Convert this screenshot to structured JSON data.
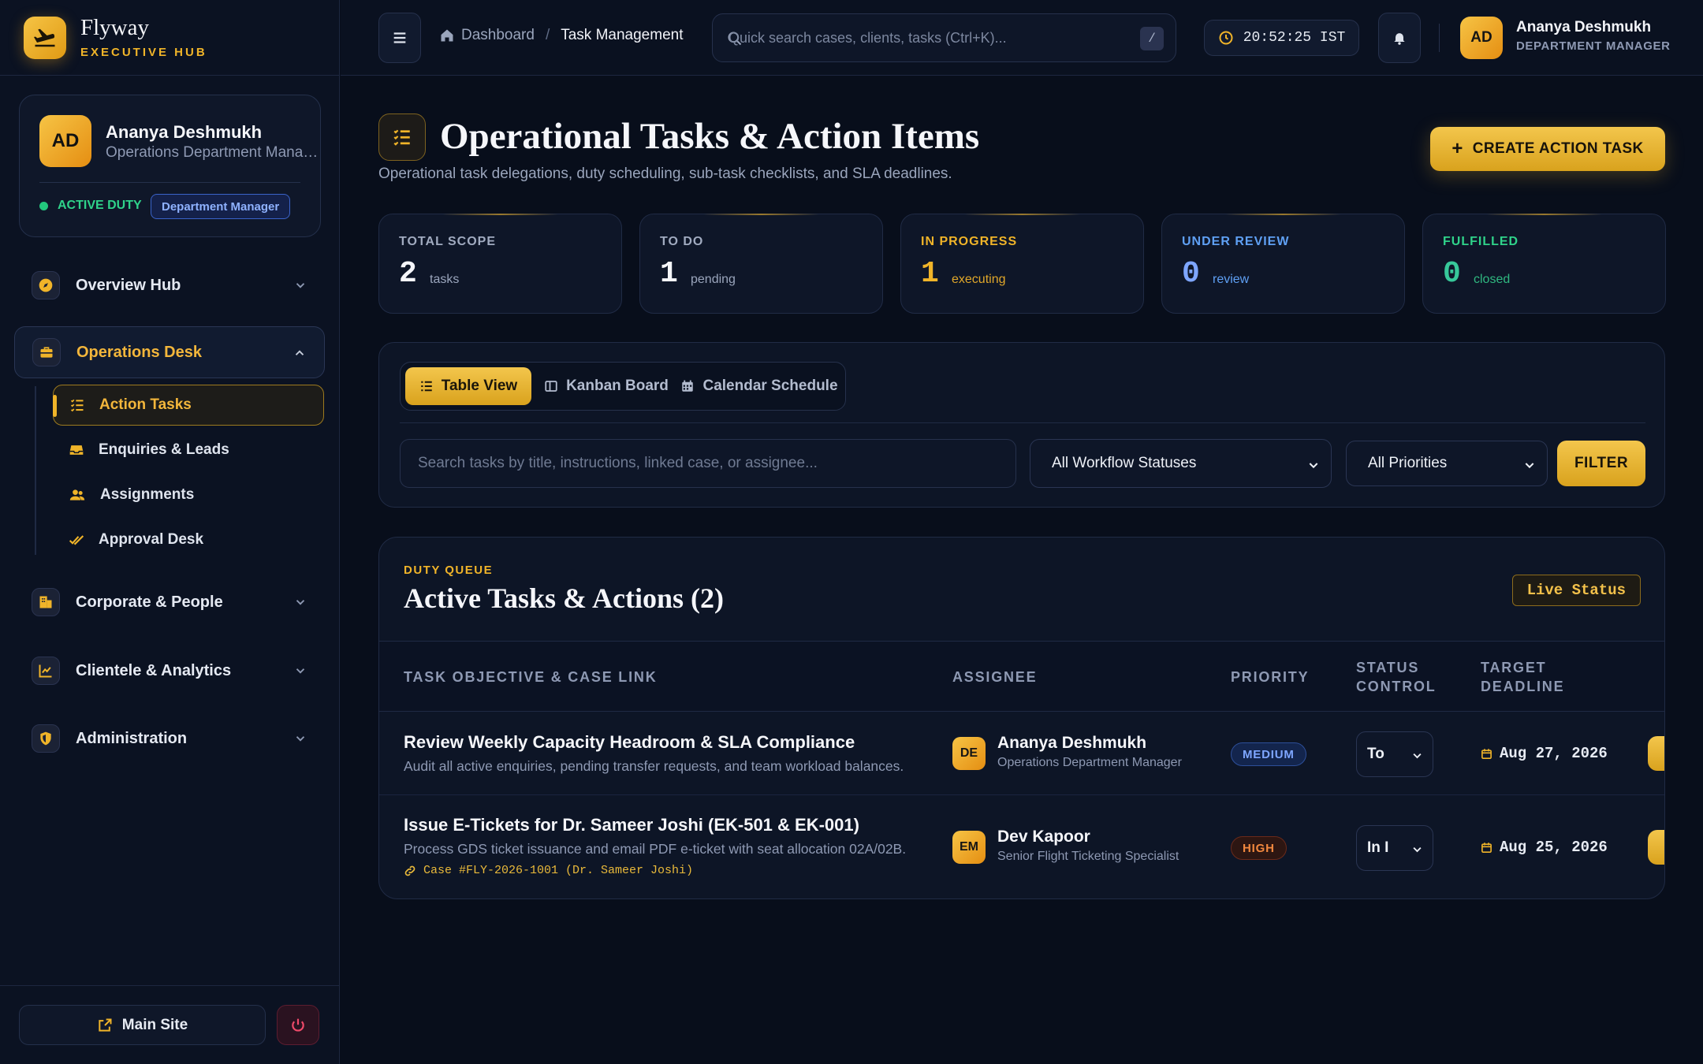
{
  "brand": {
    "name": "Flyway",
    "sub": "EXECUTIVE HUB"
  },
  "profile": {
    "initials": "AD",
    "name": "Ananya Deshmukh",
    "role": "Operations Department Manager",
    "duty": "ACTIVE DUTY",
    "badge": "Department Manager"
  },
  "nav": {
    "overview": "Overview Hub",
    "operations": "Operations Desk",
    "sub_items": [
      "Action Tasks",
      "Enquiries & Leads",
      "Assignments",
      "Approval Desk"
    ],
    "corporate": "Corporate & People",
    "clientele": "Clientele & Analytics",
    "admin": "Administration"
  },
  "footer": {
    "main_site": "Main Site"
  },
  "topbar": {
    "breadcrumb_home": "Dashboard",
    "breadcrumb_sep": "/",
    "breadcrumb_current": "Task Management",
    "search_placeholder": "Quick search cases, clients, tasks (Ctrl+K)...",
    "shortcut": "/",
    "clock": "20:52:25 IST",
    "user_initials": "AD",
    "user_name": "Ananya Deshmukh",
    "user_role": "DEPARTMENT MANAGER"
  },
  "page": {
    "title": "Operational Tasks & Action Items",
    "subtitle": "Operational task delegations, duty scheduling, sub-task checklists, and SLA deadlines.",
    "create_label": "CREATE ACTION TASK"
  },
  "stats": [
    {
      "label": "TOTAL SCOPE",
      "value": "2",
      "unit": "tasks",
      "color": "#f5f6fa",
      "label_color": "#a1abc0",
      "unit_color": "#9aa5bc"
    },
    {
      "label": "TO DO",
      "value": "1",
      "unit": "pending",
      "color": "#f5f6fa",
      "label_color": "#a1abc0",
      "unit_color": "#9aa5bc"
    },
    {
      "label": "IN PROGRESS",
      "value": "1",
      "unit": "executing",
      "color": "#f0b429",
      "label_color": "#f0b429",
      "unit_color": "#e0a72a"
    },
    {
      "label": "UNDER REVIEW",
      "value": "0",
      "unit": "review",
      "color": "#7ea6ff",
      "label_color": "#5fa0f4",
      "unit_color": "#5fa0f4"
    },
    {
      "label": "FULFILLED",
      "value": "0",
      "unit": "closed",
      "color": "#37c89a",
      "label_color": "#2fd38a",
      "unit_color": "#2fb880"
    }
  ],
  "views": {
    "table": "Table View",
    "kanban": "Kanban Board",
    "calendar": "Calendar Schedule"
  },
  "filters": {
    "search_placeholder": "Search tasks by title, instructions, linked case, or assignee...",
    "status": "All Workflow Statuses",
    "priority": "All Priorities",
    "filter_label": "FILTER"
  },
  "queue": {
    "eyebrow": "DUTY QUEUE",
    "title": "Active Tasks & Actions (2)",
    "live": "Live Status",
    "columns": {
      "objective": "TASK OBJECTIVE & CASE LINK",
      "assignee": "ASSIGNEE",
      "priority": "PRIORITY",
      "status_1": "STATUS",
      "status_2": "CONTROL",
      "deadline_1": "TARGET",
      "deadline_2": "DEADLINE"
    },
    "rows": [
      {
        "title": "Review Weekly Capacity Headroom & SLA Compliance",
        "desc": "Audit all active enquiries, pending transfer requests, and team workload balances.",
        "case": "",
        "initials": "DE",
        "assignee": "Ananya Deshmukh",
        "assignee_role": "Operations Department Manager",
        "priority": "MEDIUM",
        "status": "To",
        "deadline": "Aug 27, 2026"
      },
      {
        "title": "Issue E-Tickets for Dr. Sameer Joshi (EK-501 & EK-001)",
        "desc": "Process GDS ticket issuance and email PDF e-ticket with seat allocation 02A/02B.",
        "case": "Case #FLY-2026-1001 (Dr. Sameer Joshi)",
        "initials": "EM",
        "assignee": "Dev Kapoor",
        "assignee_role": "Senior Flight Ticketing Specialist",
        "priority": "HIGH",
        "status": "In I",
        "deadline": "Aug 25, 2026"
      }
    ]
  }
}
